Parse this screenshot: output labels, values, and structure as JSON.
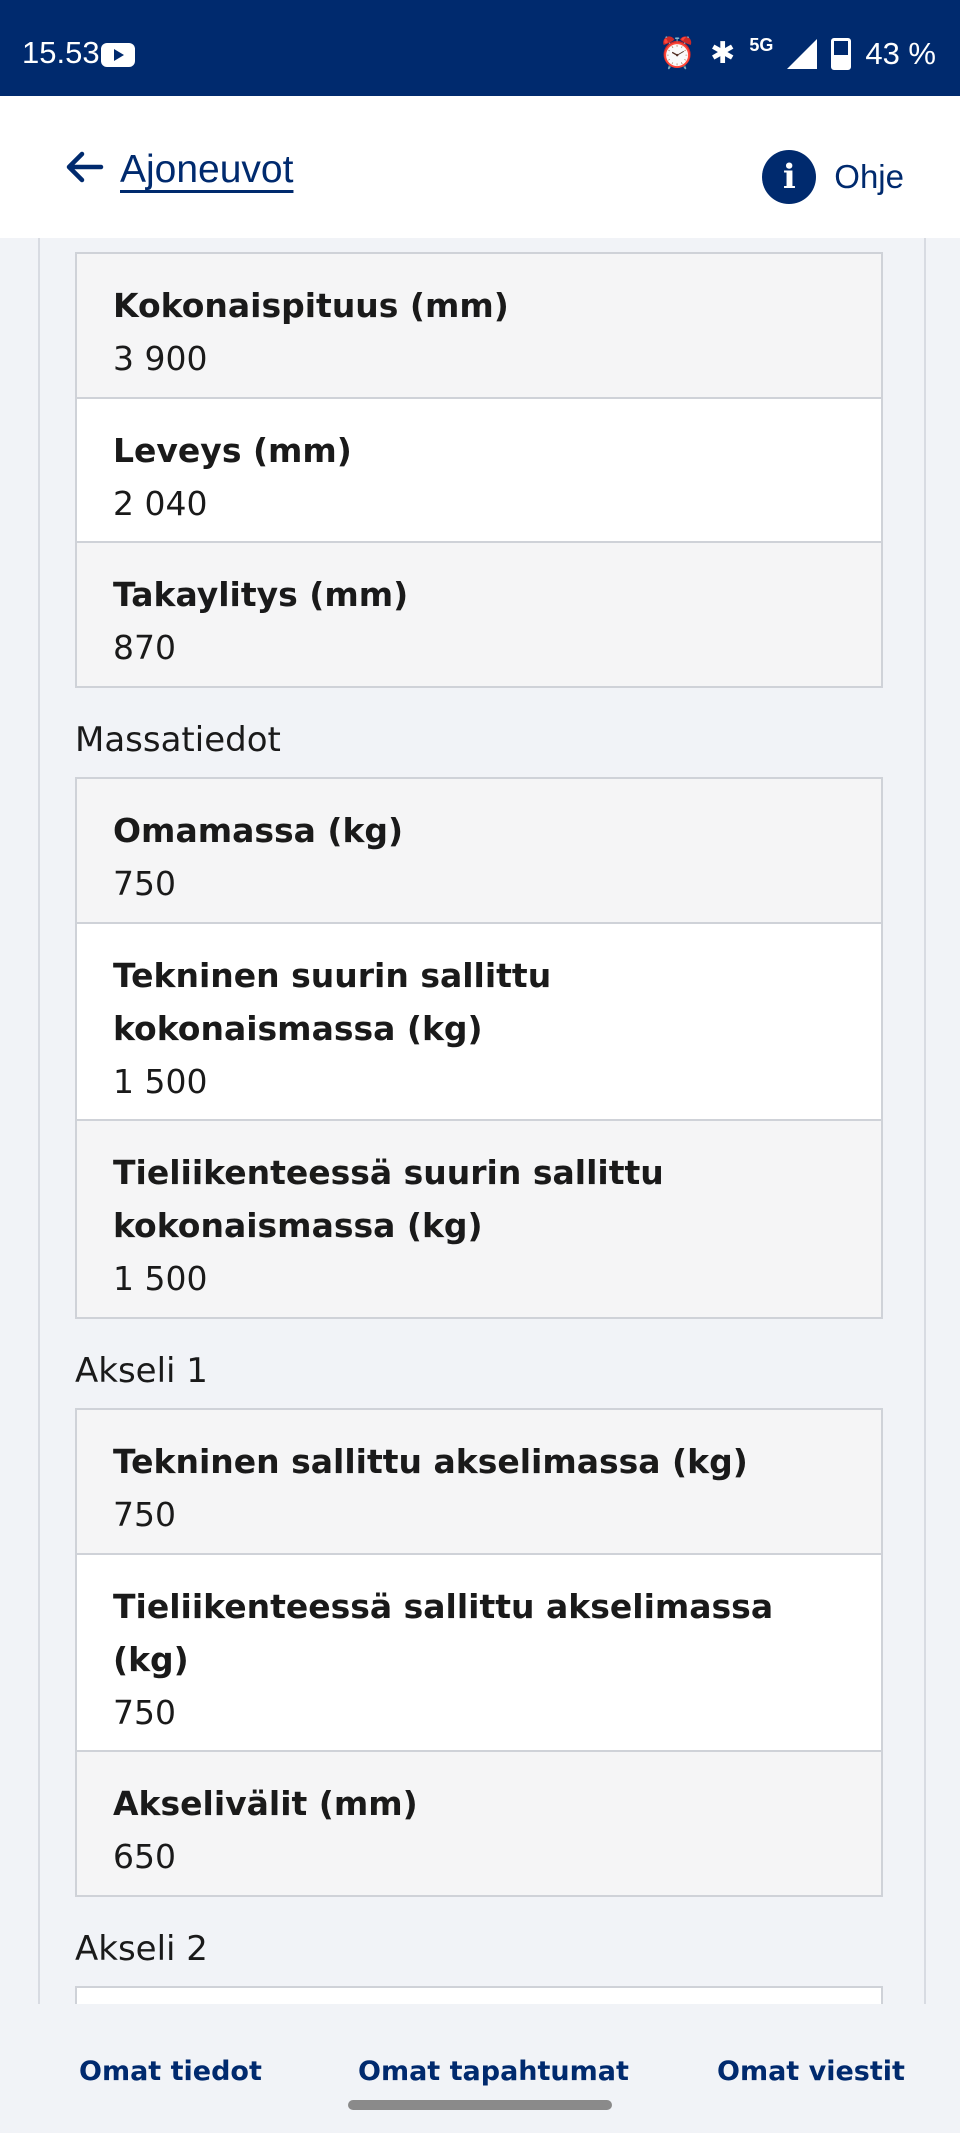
{
  "status_bar": {
    "time": "15.53",
    "network": "5G",
    "battery": "43 %",
    "icons": [
      "youtube-icon",
      "alarm-icon",
      "bluetooth-icon",
      "signal-icon",
      "battery-icon"
    ]
  },
  "header": {
    "back_label": "Ajoneuvot",
    "help_label": "Ohje",
    "help_icon_glyph": "i"
  },
  "sections": {
    "dimensions": {
      "rows": [
        {
          "label": "Kokonaispituus (mm)",
          "value": "3 900"
        },
        {
          "label": "Leveys (mm)",
          "value": "2 040"
        },
        {
          "label": "Takaylitys (mm)",
          "value": "870"
        }
      ]
    },
    "mass": {
      "title": "Massatiedot",
      "rows": [
        {
          "label": "Omamassa (kg)",
          "value": "750"
        },
        {
          "label": "Tekninen suurin sallittu kokonaismassa (kg)",
          "value": "1 500"
        },
        {
          "label": "Tieliikenteessä suurin sallittu kokonaismassa (kg)",
          "value": "1 500"
        }
      ]
    },
    "axle1": {
      "title": "Akseli 1",
      "rows": [
        {
          "label": "Tekninen sallittu akselimassa (kg)",
          "value": "750"
        },
        {
          "label": "Tieliikenteessä sallittu akselimassa (kg)",
          "value": "750"
        },
        {
          "label": "Akselivälit (mm)",
          "value": "650"
        }
      ]
    },
    "axle2": {
      "title": "Akseli 2"
    }
  },
  "bottom_nav": {
    "items": [
      "Omat tiedot",
      "Omat tapahtumat",
      "Omat viestit"
    ]
  }
}
